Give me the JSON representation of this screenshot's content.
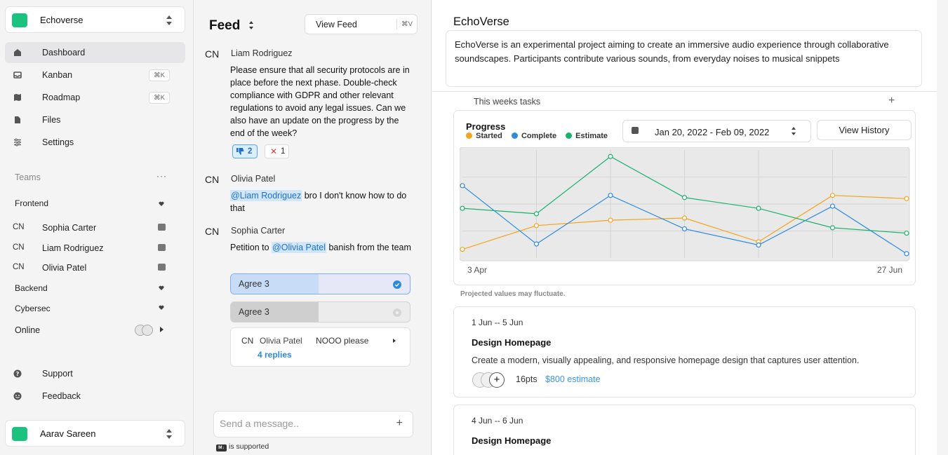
{
  "workspace": {
    "name": "Echoverse",
    "logo_color": "#19c37d"
  },
  "nav": [
    {
      "label": "Dashboard",
      "icon": "home-icon",
      "active": true
    },
    {
      "label": "Kanban",
      "icon": "inbox-icon",
      "shortcut": "⌘K"
    },
    {
      "label": "Roadmap",
      "icon": "map-icon",
      "shortcut": "⌘K"
    },
    {
      "label": "Files",
      "icon": "file-icon"
    },
    {
      "label": "Settings",
      "icon": "sliders-icon"
    }
  ],
  "teams": {
    "header": "Teams",
    "more": "···",
    "frontend": "Frontend",
    "members": [
      {
        "initials": "CN",
        "name": "Sophia Carter"
      },
      {
        "initials": "CN",
        "name": "Liam Rodriguez"
      },
      {
        "initials": "CN",
        "name": "Olivia Patel"
      }
    ],
    "backend": "Backend",
    "cybersec": "Cybersec",
    "online": "Online"
  },
  "bottom_nav": [
    {
      "label": "Support",
      "icon": "help-icon"
    },
    {
      "label": "Feedback",
      "icon": "smile-icon"
    }
  ],
  "user": {
    "name": "Aarav Sareen",
    "avatar_color": "#19c37d"
  },
  "feed": {
    "title": "Feed",
    "view_button": "View Feed",
    "view_shortcut": "⌘V",
    "posts": [
      {
        "initials": "CN",
        "author": "Liam Rodriguez",
        "body": "Please ensure that all security protocols are in place before the next phase. Double-check compliance with GDPR and other relevant regulations to avoid any legal issues. Can we also have an update on the progress by the end of the week?",
        "reactions": {
          "thumbs_down": "2",
          "cross": "1"
        }
      },
      {
        "initials": "CN",
        "author": "Olivia Patel",
        "mention": "@Liam Rodriguez",
        "body": " bro I don't know how to do that"
      },
      {
        "initials": "CN",
        "author": "Sophia Carter",
        "body_prefix": "Petition to ",
        "mention": "@Olivia Patel",
        "body_suffix": " banish from the team",
        "poll": [
          {
            "label": "Agree 3",
            "fraction": 0.49,
            "selected": true
          },
          {
            "label": "Agree 3",
            "fraction": 0.49,
            "selected": false
          }
        ],
        "thread": {
          "initials": "CN",
          "author": "Olivia Patel",
          "message": "NOOO please",
          "replies": "4 replies"
        }
      }
    ],
    "message_placeholder": "Send a message..",
    "markdown_badge": "M↓",
    "markdown_note": "is supported"
  },
  "project": {
    "title": "EchoVerse",
    "description": "EchoVerse is an experimental project aiming to create an immersive audio experience through collaborative soundscapes. Participants contribute various sounds, from everyday noises to musical snippets",
    "tasks_label": "This weeks tasks",
    "note": "Projected values may fluctuate."
  },
  "chart_data": {
    "type": "line",
    "title": "Progress",
    "date_range": "Jan 20, 2022 - Feb 09, 2022",
    "history_button": "View History",
    "x_start_label": "3 Apr",
    "x_end_label": "27 Jun",
    "grid": true,
    "legend_position": "top-left",
    "ylim": [
      0,
      1
    ],
    "series": [
      {
        "name": "Started",
        "color": "#f5a31a",
        "values": [
          0.08,
          0.3,
          0.35,
          0.37,
          0.15,
          0.58,
          0.55
        ]
      },
      {
        "name": "Complete",
        "color": "#2d8ae0",
        "values": [
          0.67,
          0.13,
          0.58,
          0.27,
          0.12,
          0.48,
          0.04
        ]
      },
      {
        "name": "Estimate",
        "color": "#19b26b",
        "values": [
          0.46,
          0.41,
          0.94,
          0.56,
          0.46,
          0.28,
          0.23
        ]
      }
    ]
  },
  "tasks": [
    {
      "dates": "1 Jun -- 5 Jun",
      "title": "Design Homepage",
      "description": "Create a modern, visually appealing, and responsive homepage design that captures user attention.",
      "points": "16pts",
      "estimate": "$800 estimate",
      "add": "+"
    },
    {
      "dates": "4 Jun -- 6 Jun",
      "title": "Design Homepage"
    }
  ]
}
